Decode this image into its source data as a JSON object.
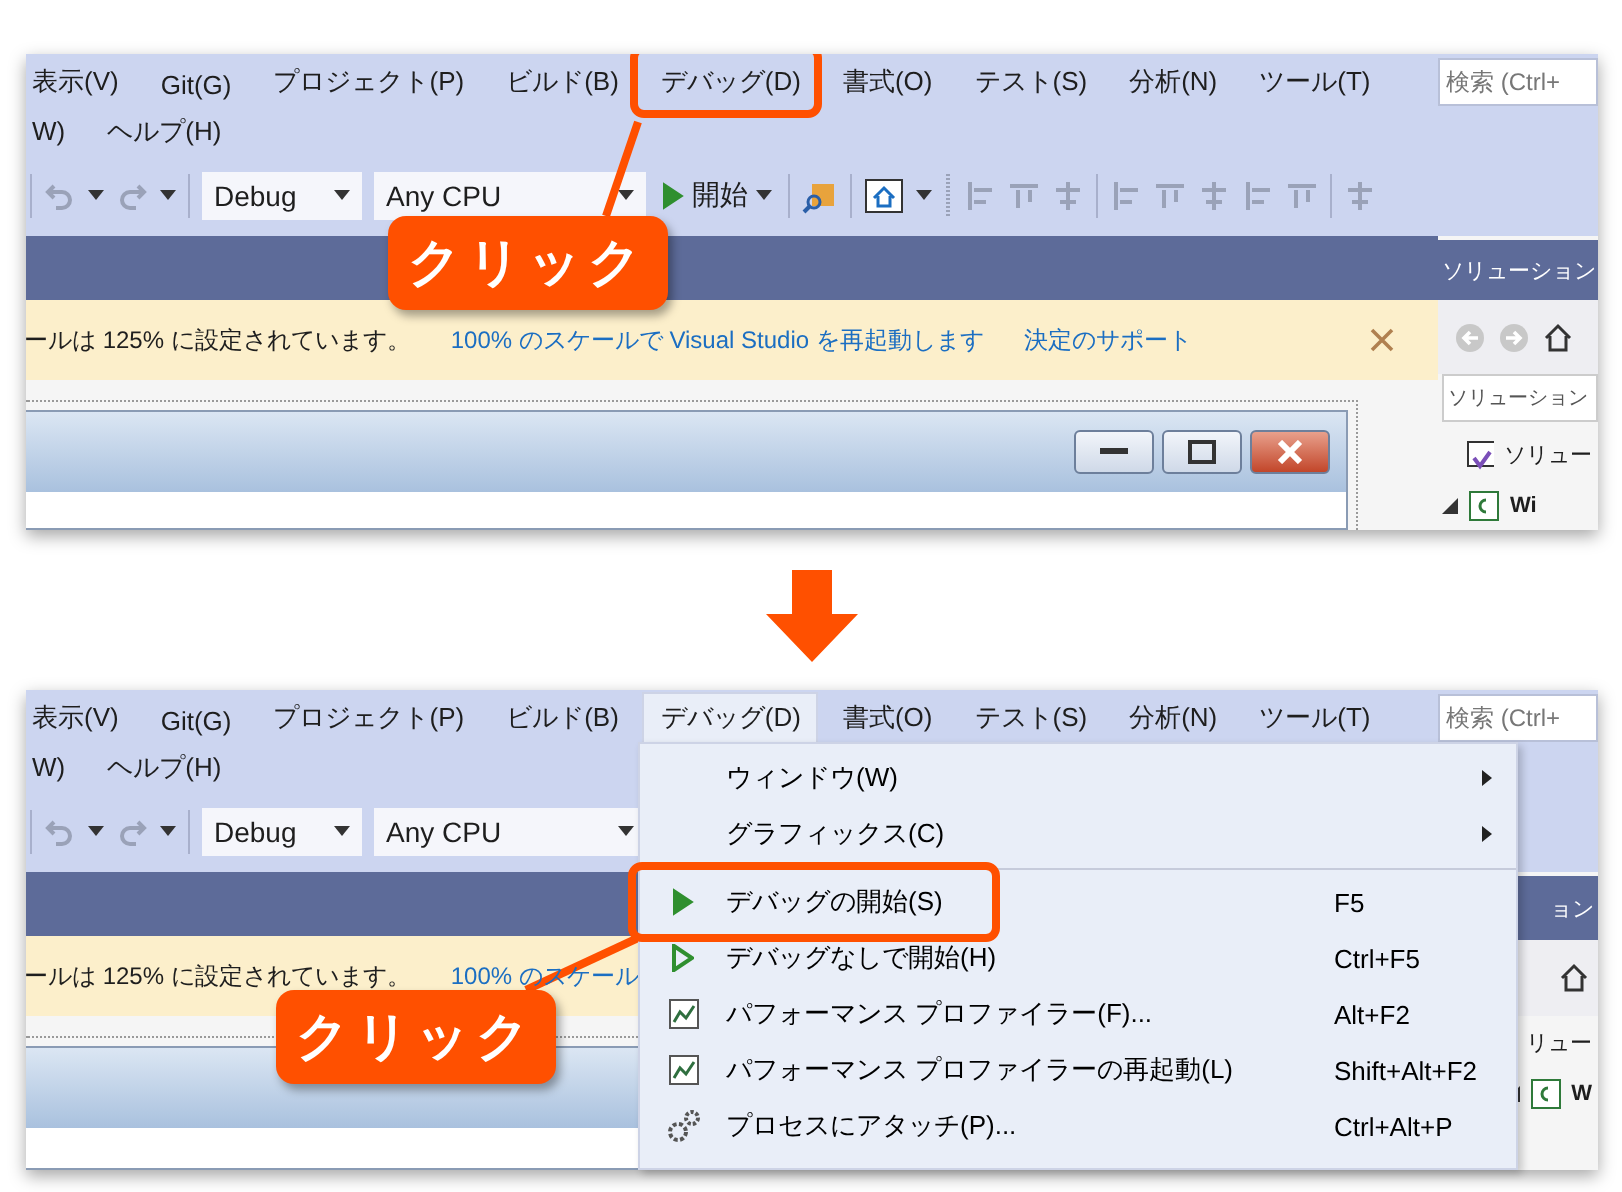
{
  "before": {
    "menu": [
      {
        "label": "表示(V)",
        "selected": false,
        "highlighted": false
      },
      {
        "label": "Git(G)",
        "selected": false,
        "highlighted": false
      },
      {
        "label": "プロジェクト(P)",
        "selected": false,
        "highlighted": false
      },
      {
        "label": "ビルド(B)",
        "selected": false,
        "highlighted": false
      },
      {
        "label": "デバッグ(D)",
        "selected": false,
        "highlighted": true
      },
      {
        "label": "書式(O)",
        "selected": false,
        "highlighted": false
      },
      {
        "label": "テスト(S)",
        "selected": false,
        "highlighted": false
      },
      {
        "label": "分析(N)",
        "selected": false,
        "highlighted": false
      },
      {
        "label": "ツール(T)",
        "selected": false,
        "highlighted": false
      }
    ],
    "menu_row2": [
      "W)",
      "ヘルプ(H)"
    ],
    "search": {
      "placeholder": "検索 (Ctrl+"
    },
    "toolbar": {
      "configuration": "Debug",
      "platform": "Any CPU",
      "start": "開始"
    },
    "info_bar": {
      "message": "ールは 125% に設定されています。",
      "links": [
        "100% のスケールで Visual Studio を再起動します",
        "決定のサポート"
      ]
    },
    "solution_explorer": {
      "title": "ソリューション",
      "search_placeholder": "ソリューション",
      "items": [
        {
          "label": "ソリュー",
          "kind": "solution"
        },
        {
          "label": "Wi",
          "kind": "project"
        }
      ]
    },
    "callout": "クリック"
  },
  "after": {
    "menu": [
      {
        "label": "表示(V)",
        "selected": false,
        "highlighted": false
      },
      {
        "label": "Git(G)",
        "selected": false,
        "highlighted": false
      },
      {
        "label": "プロジェクト(P)",
        "selected": false,
        "highlighted": false
      },
      {
        "label": "ビルド(B)",
        "selected": false,
        "highlighted": false
      },
      {
        "label": "デバッグ(D)",
        "selected": true,
        "highlighted": false
      },
      {
        "label": "書式(O)",
        "selected": false,
        "highlighted": false
      },
      {
        "label": "テスト(S)",
        "selected": false,
        "highlighted": false
      },
      {
        "label": "分析(N)",
        "selected": false,
        "highlighted": false
      },
      {
        "label": "ツール(T)",
        "selected": false,
        "highlighted": false
      }
    ],
    "menu_row2": [
      "W)",
      "ヘルプ(H)"
    ],
    "search": {
      "placeholder": "検索 (Ctrl+"
    },
    "toolbar": {
      "configuration": "Debug",
      "platform": "Any CPU"
    },
    "info_bar": {
      "message": "ールは 125% に設定されています。",
      "links": [
        "100% のスケール"
      ]
    },
    "solution_explorer": {
      "title": "ョン",
      "items": [
        {
          "label": "リュー"
        },
        {
          "label": "W",
          "kind": "project"
        }
      ]
    },
    "dropdown": [
      {
        "label": "ウィンドウ(W)",
        "kind": "submenu",
        "highlighted": false
      },
      {
        "label": "グラフィックス(C)",
        "kind": "submenu",
        "highlighted": false
      },
      {
        "kind": "separator"
      },
      {
        "label": "デバッグの開始(S)",
        "shortcut": "F5",
        "kind": "start",
        "highlighted": true
      },
      {
        "label": "デバッグなしで開始(H)",
        "shortcut": "Ctrl+F5",
        "kind": "start-no-debug",
        "highlighted": false
      },
      {
        "label": "パフォーマンス プロファイラー(F)...",
        "shortcut": "Alt+F2",
        "kind": "profiler",
        "highlighted": false
      },
      {
        "label": "パフォーマンス プロファイラーの再起動(L)",
        "shortcut": "Shift+Alt+F2",
        "kind": "profiler",
        "highlighted": false
      },
      {
        "label": "プロセスにアタッチ(P)...",
        "shortcut": "Ctrl+Alt+P",
        "kind": "attach",
        "highlighted": false
      }
    ],
    "callout": "クリック"
  }
}
